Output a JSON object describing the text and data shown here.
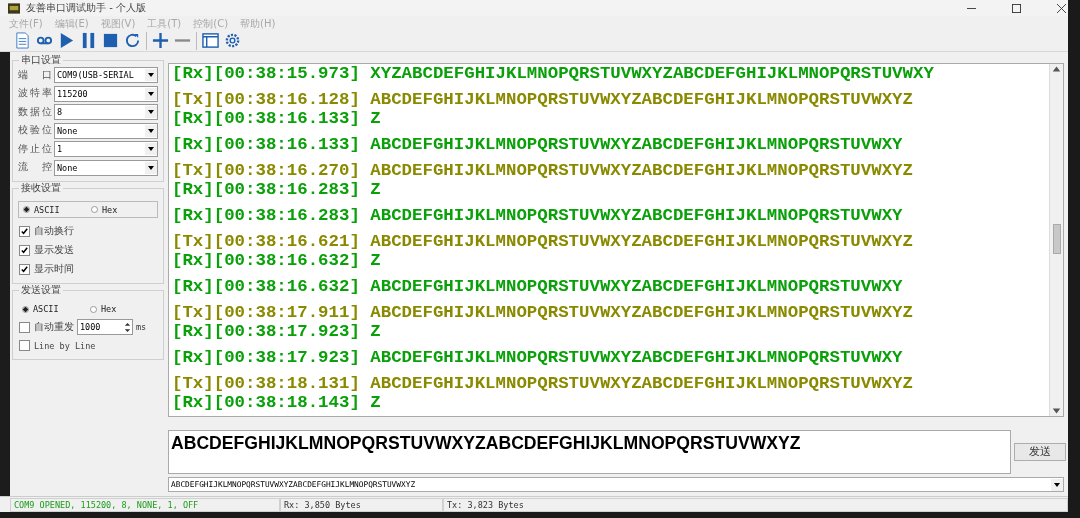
{
  "window": {
    "title": "友善串口调试助手 - 个人版"
  },
  "menu": [
    "文件(F)",
    "编辑(E)",
    "视图(V)",
    "工具(T)",
    "控制(C)",
    "帮助(H)"
  ],
  "serial_settings": {
    "title": "串口设置",
    "fields": [
      {
        "label": "端 口",
        "value": "COM9(USB-SERIAL"
      },
      {
        "label": "波特率",
        "value": "115200"
      },
      {
        "label": "数据位",
        "value": "8"
      },
      {
        "label": "校验位",
        "value": "None"
      },
      {
        "label": "停止位",
        "value": "1"
      },
      {
        "label": "流 控",
        "value": "None"
      }
    ]
  },
  "receive_settings": {
    "title": "接收设置",
    "modes": [
      {
        "label": "ASCII",
        "selected": true
      },
      {
        "label": "Hex",
        "selected": false
      }
    ],
    "options": [
      {
        "label": "自动换行",
        "checked": true
      },
      {
        "label": "显示发送",
        "checked": true
      },
      {
        "label": "显示时间",
        "checked": true
      }
    ]
  },
  "send_settings": {
    "title": "发送设置",
    "modes": [
      {
        "label": "ASCII",
        "selected": true
      },
      {
        "label": "Hex",
        "selected": false
      }
    ],
    "auto_resend": {
      "label": "自动重发",
      "checked": false,
      "value": "1000",
      "unit": "ms"
    },
    "line_by_line": {
      "label": "Line by Line",
      "checked": false
    }
  },
  "log": {
    "groups": [
      [
        {
          "kind": "rx",
          "tag": "[Rx]",
          "time": "[00:38:15.973]",
          "data": "XYZABCDEFGHIJKLMNOPQRSTUVWXYZABCDEFGHIJKLMNOPQRSTUVWXY"
        }
      ],
      [
        {
          "kind": "tx",
          "tag": "[Tx]",
          "time": "[00:38:16.128]",
          "data": "ABCDEFGHIJKLMNOPQRSTUVWXYZABCDEFGHIJKLMNOPQRSTUVWXYZ"
        },
        {
          "kind": "rx",
          "tag": "[Rx]",
          "time": "[00:38:16.133]",
          "data": "Z"
        }
      ],
      [
        {
          "kind": "rx",
          "tag": "[Rx]",
          "time": "[00:38:16.133]",
          "data": "ABCDEFGHIJKLMNOPQRSTUVWXYZABCDEFGHIJKLMNOPQRSTUVWXY"
        }
      ],
      [
        {
          "kind": "tx",
          "tag": "[Tx]",
          "time": "[00:38:16.270]",
          "data": "ABCDEFGHIJKLMNOPQRSTUVWXYZABCDEFGHIJKLMNOPQRSTUVWXYZ"
        },
        {
          "kind": "rx",
          "tag": "[Rx]",
          "time": "[00:38:16.283]",
          "data": "Z"
        }
      ],
      [
        {
          "kind": "rx",
          "tag": "[Rx]",
          "time": "[00:38:16.283]",
          "data": "ABCDEFGHIJKLMNOPQRSTUVWXYZABCDEFGHIJKLMNOPQRSTUVWXY"
        }
      ],
      [
        {
          "kind": "tx",
          "tag": "[Tx]",
          "time": "[00:38:16.621]",
          "data": "ABCDEFGHIJKLMNOPQRSTUVWXYZABCDEFGHIJKLMNOPQRSTUVWXYZ"
        },
        {
          "kind": "rx",
          "tag": "[Rx]",
          "time": "[00:38:16.632]",
          "data": "Z"
        }
      ],
      [
        {
          "kind": "rx",
          "tag": "[Rx]",
          "time": "[00:38:16.632]",
          "data": "ABCDEFGHIJKLMNOPQRSTUVWXYZABCDEFGHIJKLMNOPQRSTUVWXY"
        }
      ],
      [
        {
          "kind": "tx",
          "tag": "[Tx]",
          "time": "[00:38:17.911]",
          "data": "ABCDEFGHIJKLMNOPQRSTUVWXYZABCDEFGHIJKLMNOPQRSTUVWXYZ"
        },
        {
          "kind": "rx",
          "tag": "[Rx]",
          "time": "[00:38:17.923]",
          "data": "Z"
        }
      ],
      [
        {
          "kind": "rx",
          "tag": "[Rx]",
          "time": "[00:38:17.923]",
          "data": "ABCDEFGHIJKLMNOPQRSTUVWXYZABCDEFGHIJKLMNOPQRSTUVWXY"
        }
      ],
      [
        {
          "kind": "tx",
          "tag": "[Tx]",
          "time": "[00:38:18.131]",
          "data": "ABCDEFGHIJKLMNOPQRSTUVWXYZABCDEFGHIJKLMNOPQRSTUVWXYZ"
        },
        {
          "kind": "rx",
          "tag": "[Rx]",
          "time": "[00:38:18.143]",
          "data": "Z"
        }
      ]
    ]
  },
  "send_input": {
    "value": "ABCDEFGHIJKLMNOPQRSTUVWXYZABCDEFGHIJKLMNOPQRSTUVWXYZ"
  },
  "send_button": "发送",
  "history": {
    "value": "ABCDEFGHIJKLMNOPQRSTUVWXYZABCDEFGHIJKLMNOPQRSTUVWXYZ"
  },
  "status_bar": [
    "COM9 OPENED, 115200, 8, NONE, 1, OFF",
    "Rx: 3,850 Bytes",
    "Tx: 3,823 Bytes"
  ]
}
